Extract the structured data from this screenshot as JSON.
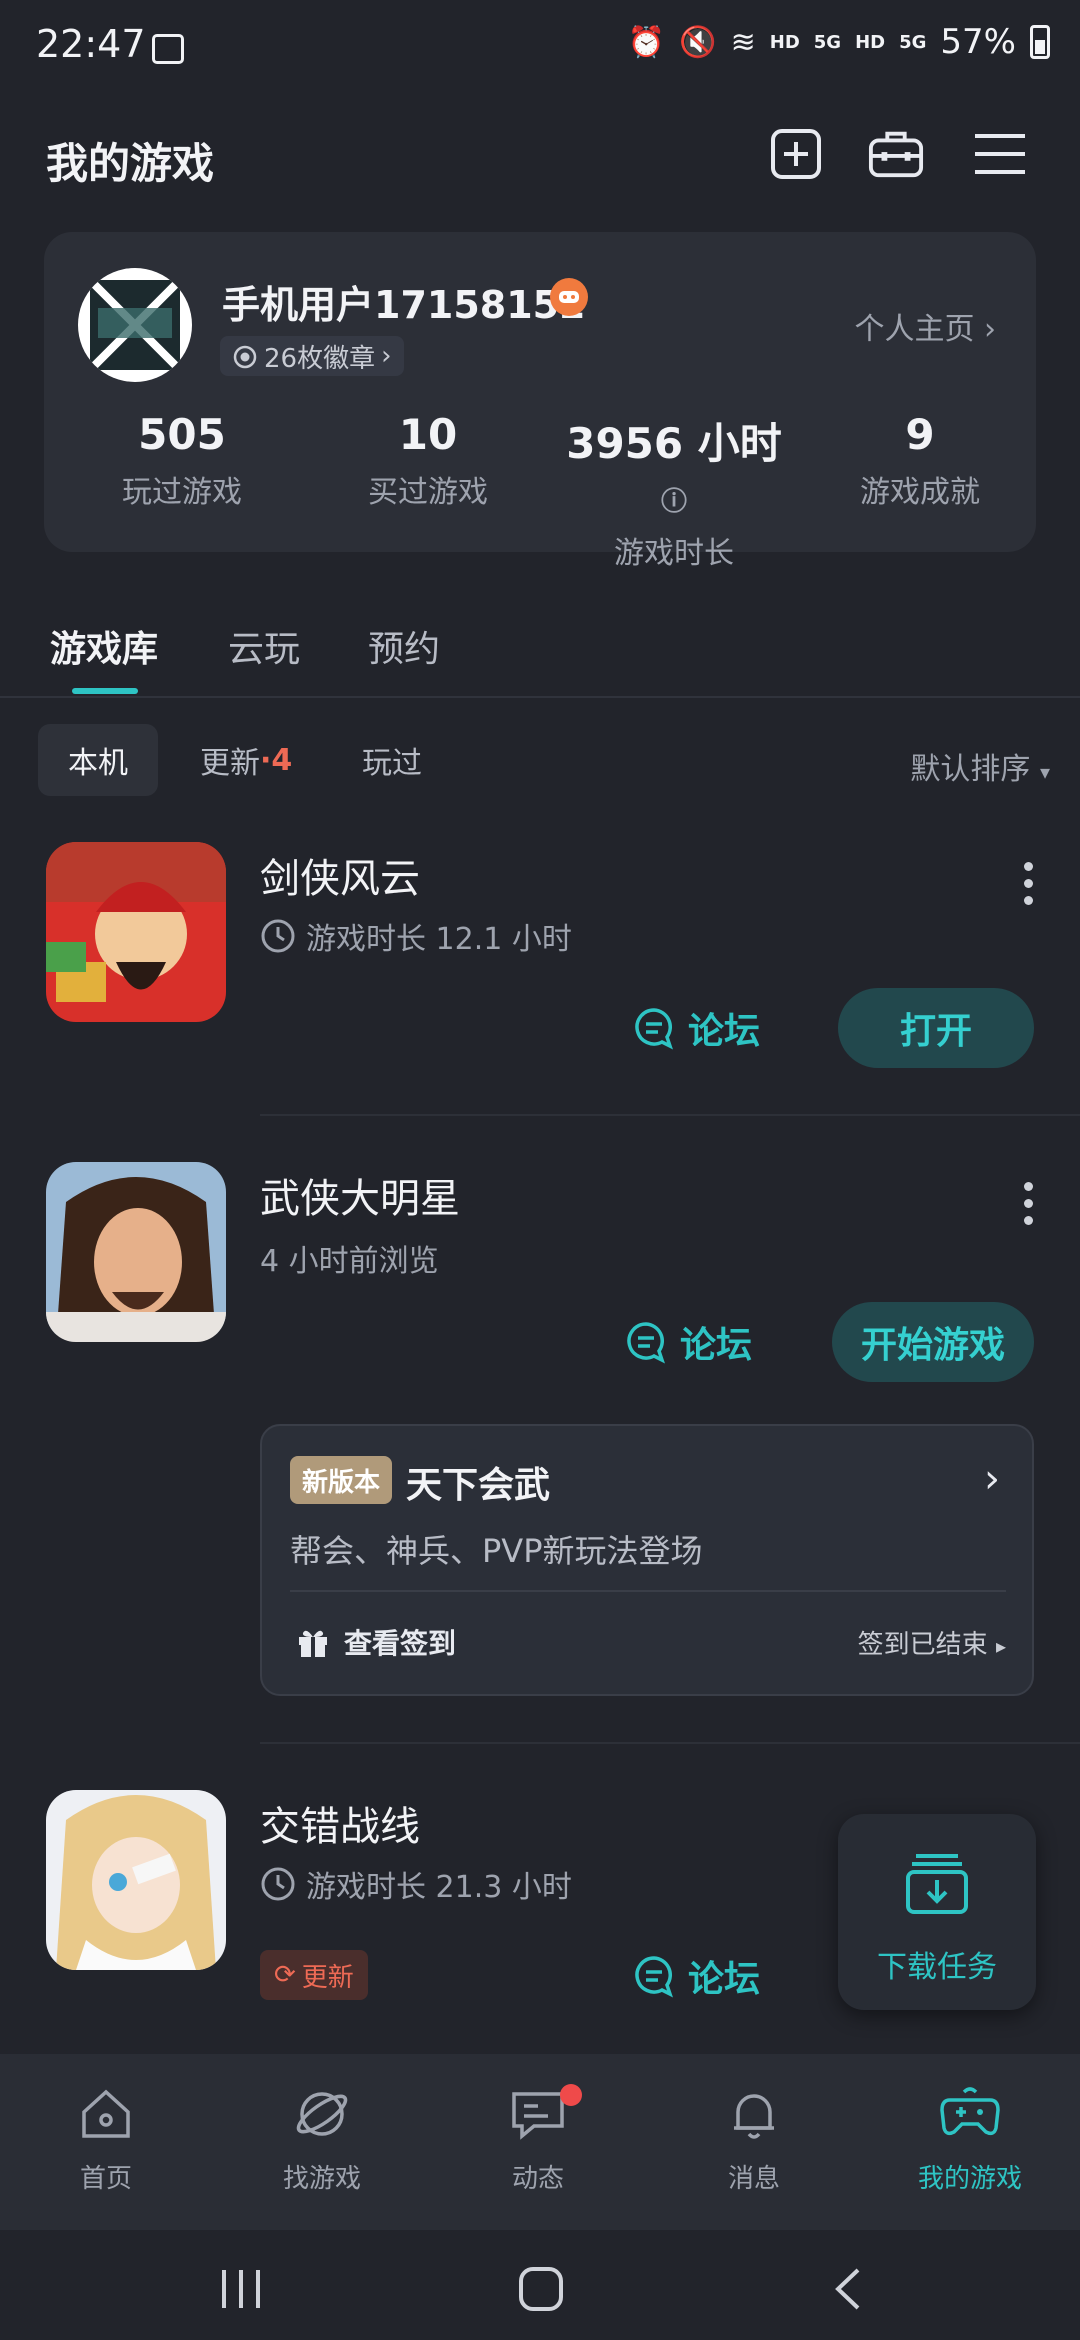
{
  "status_bar": {
    "time": "22:47",
    "net1": "HD",
    "net2": "5G",
    "net3": "HD",
    "net4": "5G",
    "battery": "57%"
  },
  "header": {
    "title": "我的游戏"
  },
  "profile": {
    "username": "手机用户17158152",
    "medals": "26枚徽章",
    "homepage": "个人主页",
    "stats": [
      {
        "value": "505",
        "label": "玩过游戏"
      },
      {
        "value": "10",
        "label": "买过游戏"
      },
      {
        "value": "3956 小时",
        "label": "游戏时长"
      },
      {
        "value": "9",
        "label": "游戏成就"
      }
    ]
  },
  "tabs": [
    "游戏库",
    "云玩",
    "预约"
  ],
  "filters": {
    "local": "本机",
    "update": "更新",
    "update_count": "·4",
    "played": "玩过",
    "sort": "默认排序"
  },
  "games": [
    {
      "name": "剑侠风云",
      "sub": "游戏时长 12.1 小时",
      "forum": "论坛",
      "action": "打开"
    },
    {
      "name": "武侠大明星",
      "sub": "4 小时前浏览",
      "forum": "论坛",
      "action": "开始游戏"
    },
    {
      "name": "交错战线",
      "sub": "游戏时长 21.3 小时",
      "forum": "论坛",
      "update": "更新"
    }
  ],
  "event": {
    "tag": "新版本",
    "title": "天下会武",
    "desc": "帮会、神兵、PVP新玩法登场",
    "checkin": "查看签到",
    "checkin_status": "签到已结束"
  },
  "download": {
    "label": "下载任务"
  },
  "bottom_nav": [
    "首页",
    "找游戏",
    "动态",
    "消息",
    "我的游戏"
  ],
  "colors": {
    "accent": "#2ec4c4",
    "bg": "#22242b",
    "card": "#2c2f37",
    "update": "#ee6a55"
  }
}
